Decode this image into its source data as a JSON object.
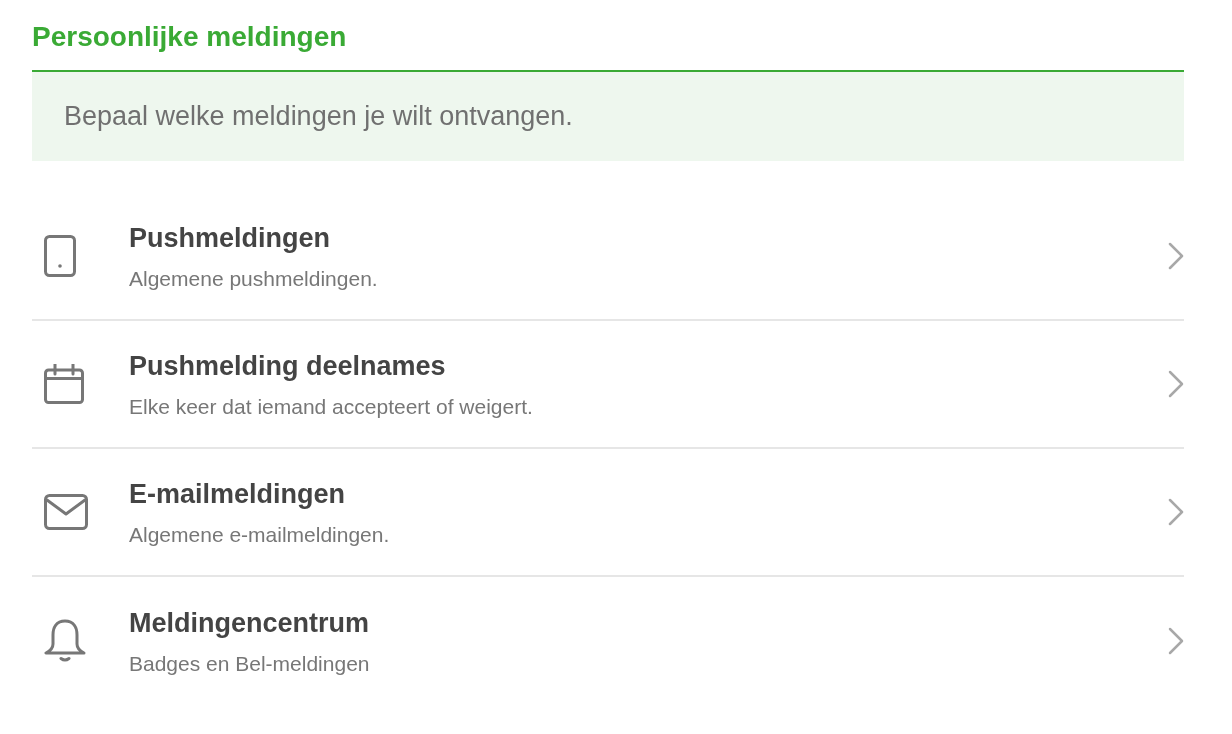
{
  "header": {
    "title": "Persoonlijke meldingen"
  },
  "intro": {
    "text": "Bepaal welke meldingen je wilt ontvangen."
  },
  "settings": [
    {
      "title": "Pushmeldingen",
      "subtitle": "Algemene pushmeldingen."
    },
    {
      "title": "Pushmelding deelnames",
      "subtitle": "Elke keer dat iemand accepteert of weigert."
    },
    {
      "title": "E-mailmeldingen",
      "subtitle": "Algemene e-mailmeldingen."
    },
    {
      "title": "Meldingencentrum",
      "subtitle": "Badges en Bel-meldingen"
    }
  ]
}
